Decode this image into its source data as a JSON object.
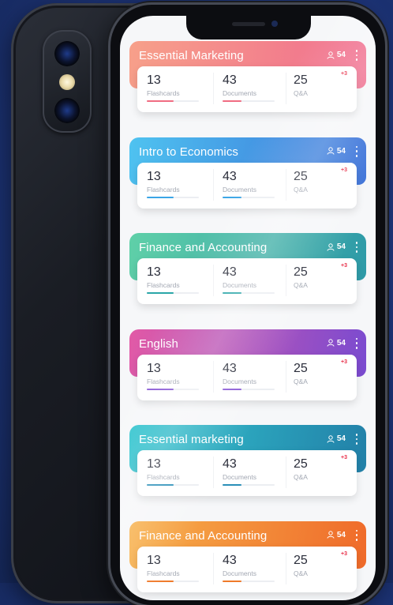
{
  "courses": [
    {
      "title": "Essential Marketing",
      "members": "54",
      "gradient": [
        "#f7a08a",
        "#f06c8e"
      ],
      "accent": "#f06c82",
      "flashcards": "13",
      "flashcards_label": "Flashcards",
      "documents": "43",
      "documents_label": "Documents",
      "qa": "25",
      "qa_label": "Q&A",
      "badge": "+3"
    },
    {
      "title": "Intro to Economics",
      "members": "54",
      "gradient": [
        "#4fc3f0",
        "#3a6fd8"
      ],
      "accent": "#3aa5e6",
      "flashcards": "13",
      "flashcards_label": "Flashcards",
      "documents": "43",
      "documents_label": "Documents",
      "qa": "25",
      "qa_label": "Q&A",
      "badge": "+3"
    },
    {
      "title": "Finance and Accounting",
      "members": "54",
      "gradient": [
        "#5fd0a8",
        "#2e9aa8"
      ],
      "accent": "#2aa6a8",
      "flashcards": "13",
      "flashcards_label": "Flashcards",
      "documents": "43",
      "documents_label": "Documents",
      "qa": "25",
      "qa_label": "Q&A",
      "badge": "+3"
    },
    {
      "title": "English",
      "members": "54",
      "gradient": [
        "#e25aa6",
        "#7a4bd0"
      ],
      "accent": "#8a5ad6",
      "flashcards": "13",
      "flashcards_label": "Flashcards",
      "documents": "43",
      "documents_label": "Documents",
      "qa": "25",
      "qa_label": "Q&A",
      "badge": "+3"
    },
    {
      "title": "Essential marketing",
      "members": "54",
      "gradient": [
        "#34c6d0",
        "#2280a8"
      ],
      "accent": "#2a8fb8",
      "flashcards": "13",
      "flashcards_label": "Flashcards",
      "documents": "43",
      "documents_label": "Documents",
      "qa": "25",
      "qa_label": "Q&A",
      "badge": "+3"
    },
    {
      "title": "Finance and Accounting",
      "members": "54",
      "gradient": [
        "#f7b04a",
        "#ef6a2a"
      ],
      "accent": "#ef7a2a",
      "flashcards": "13",
      "flashcards_label": "Flashcards",
      "documents": "43",
      "documents_label": "Documents",
      "qa": "25",
      "qa_label": "Q&A",
      "badge": "+3"
    }
  ]
}
